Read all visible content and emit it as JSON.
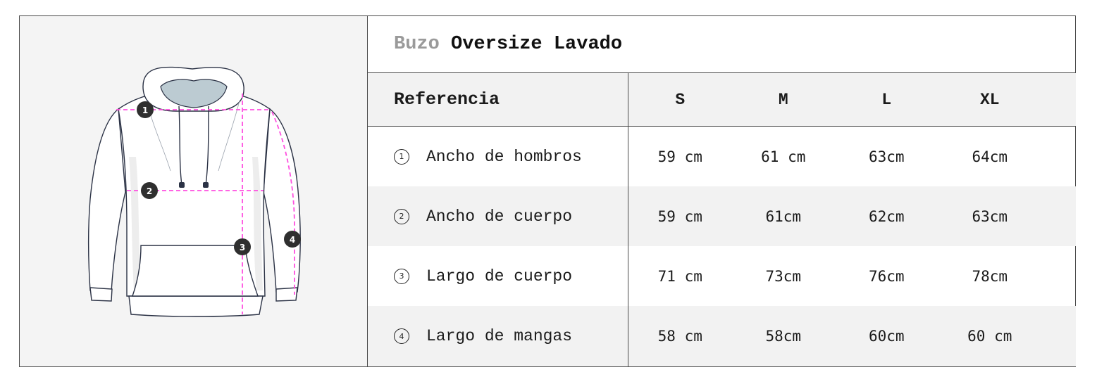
{
  "product": {
    "title_prefix": "Buzo",
    "title_main": "Oversize Lavado"
  },
  "table": {
    "header": {
      "reference": "Referencia",
      "sizes": [
        "S",
        "M",
        "L",
        "XL"
      ]
    },
    "rows": [
      {
        "number": "1",
        "label": "Ancho de hombros",
        "values": [
          "59 cm",
          "61 cm",
          "63cm",
          "64cm"
        ]
      },
      {
        "number": "2",
        "label": "Ancho de cuerpo",
        "values": [
          "59 cm",
          "61cm",
          "62cm",
          "63cm"
        ]
      },
      {
        "number": "3",
        "label": "Largo de cuerpo",
        "values": [
          "71 cm",
          "73cm",
          "76cm",
          "78cm"
        ]
      },
      {
        "number": "4",
        "label": "Largo de mangas",
        "values": [
          "58 cm",
          "58cm",
          "60cm",
          "60 cm"
        ]
      }
    ]
  },
  "illustration": {
    "markers": [
      "1",
      "2",
      "3",
      "4"
    ],
    "measure_color": "#ff4fe0",
    "marker_color": "#2f2f2f"
  }
}
